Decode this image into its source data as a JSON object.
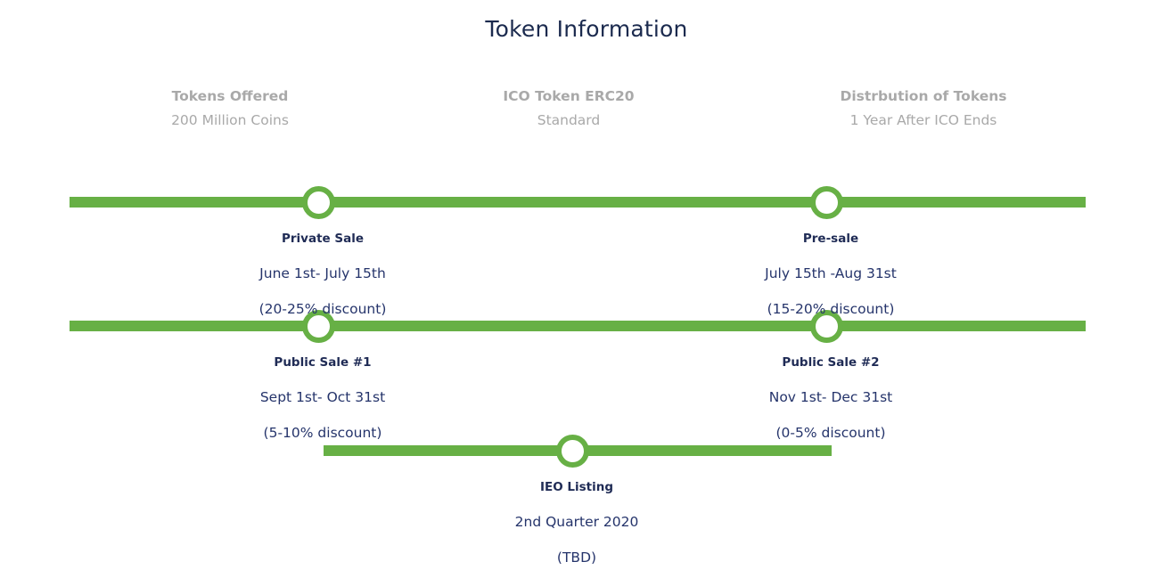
{
  "page": {
    "title": "Token Information"
  },
  "info": [
    {
      "heading": "Tokens Offered",
      "value": "200 Million Coins"
    },
    {
      "heading": "ICO Token ERC20",
      "value": "Standard"
    },
    {
      "heading": "Distrbution of Tokens",
      "value": "1 Year After ICO Ends"
    }
  ],
  "milestones": [
    {
      "name": "Private Sale",
      "dates": "June 1st- July 15th",
      "note": "(20-25% discount)"
    },
    {
      "name": "Pre-sale",
      "dates": "July 15th -Aug 31st",
      "note": "(15-20% discount)"
    },
    {
      "name": "Public Sale #1",
      "dates": "Sept 1st- Oct 31st",
      "note": "(5-10% discount)"
    },
    {
      "name": "Public Sale #2",
      "dates": "Nov 1st- Dec 31st",
      "note": "(0-5% discount)"
    },
    {
      "name": "IEO Listing",
      "dates": "2nd Quarter 2020",
      "note": "(TBD)"
    }
  ],
  "colors": {
    "accent": "#67b045",
    "title": "#1b2a4e",
    "muted": "#a9a9a9",
    "text": "#25346b"
  }
}
